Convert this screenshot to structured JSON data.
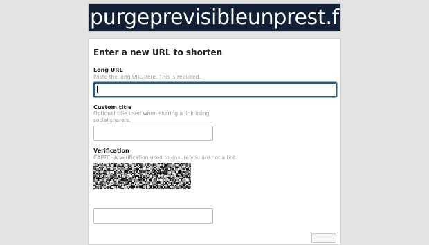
{
  "site": {
    "title": "purgeprevisibleunprest.forum"
  },
  "form": {
    "title": "Enter a new URL to shorten",
    "long_url": {
      "label": "Long URL",
      "help": "Paste the long URL here. This is required.",
      "value": ""
    },
    "custom_title": {
      "label": "Custom title",
      "help": "Optional title used when sharing a link using social sharers.",
      "value": ""
    },
    "verification": {
      "label": "Verification",
      "help": "CAPTCHA verification used to ensure you are not a bot.",
      "captcha_text": "344",
      "answer_value": ""
    }
  },
  "colors": {
    "banner_bg": "#142035",
    "page_bg": "#e3e3e3",
    "focus_border": "#2c5a80"
  }
}
